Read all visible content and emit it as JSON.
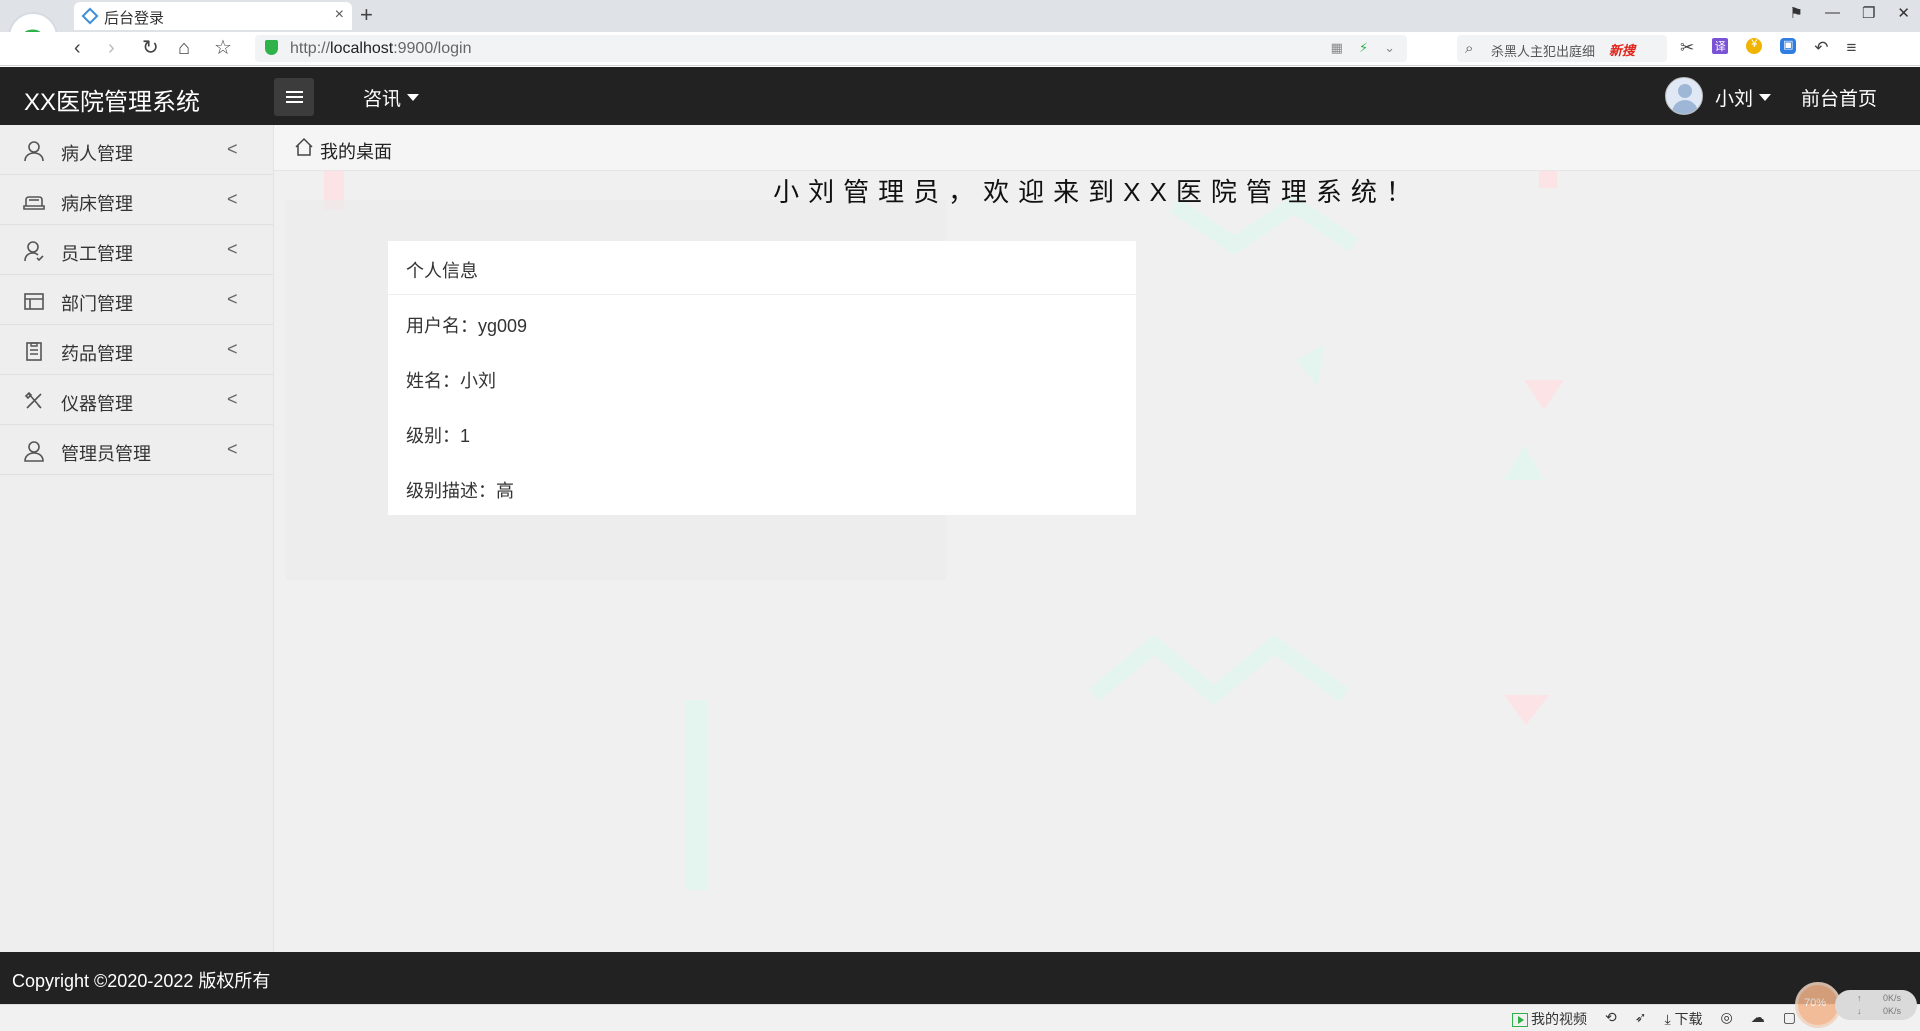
{
  "browser": {
    "tab_title": "后台登录",
    "url_prefix": "http://",
    "url_host": "localhost",
    "url_rest": ":9900/login",
    "search_text": "杀黑人主犯出庭细",
    "hot_badge": "新搜",
    "tab_close": "×",
    "new_tab": "+"
  },
  "header": {
    "brand": "XX医院管理系统",
    "news_menu": "咨讯",
    "user_name": "小刘",
    "front_link": "前台首页"
  },
  "sidebar": {
    "items": [
      {
        "label": "病人管理",
        "icon": "user-icon"
      },
      {
        "label": "病床管理",
        "icon": "bed-icon"
      },
      {
        "label": "员工管理",
        "icon": "staff-icon"
      },
      {
        "label": "部门管理",
        "icon": "department-icon"
      },
      {
        "label": "药品管理",
        "icon": "clipboard-icon"
      },
      {
        "label": "仪器管理",
        "icon": "tools-icon"
      },
      {
        "label": "管理员管理",
        "icon": "admin-icon"
      }
    ],
    "chevron": "<"
  },
  "breadcrumb": {
    "label": "我的桌面"
  },
  "welcome": "小刘管理员，欢迎来到XX医院管理系统！",
  "profile": {
    "title": "个人信息",
    "rows": [
      "用户名：yg009",
      "姓名：小刘",
      "级别：1",
      "级别描述：高"
    ]
  },
  "footer": {
    "copyright": "Copyright ©2020-2022 版权所有"
  },
  "statusbar": {
    "my_video": "我的视频",
    "download": "下载"
  },
  "speed": {
    "percent": "70%",
    "up": "↑",
    "down": "↓",
    "up_rate": "0K/s",
    "down_rate": "0K/s"
  },
  "colors": {
    "header_bg": "#222222",
    "sidebar_bg": "#eeeeee",
    "main_bg": "#f0f0f0",
    "accent_green": "#2fb24a"
  }
}
